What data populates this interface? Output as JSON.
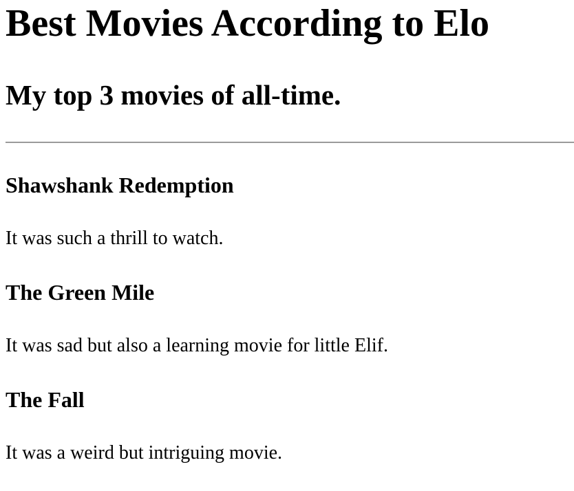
{
  "page": {
    "title": "Best Movies According to Elo",
    "subtitle": "My top 3 movies of all-time."
  },
  "movies": [
    {
      "title": "Shawshank Redemption",
      "comment": "It was such a thrill to watch."
    },
    {
      "title": "The Green Mile",
      "comment": "It was sad but also a learning movie for little Elif."
    },
    {
      "title": "The Fall",
      "comment": "It was a weird but intriguing movie."
    }
  ]
}
